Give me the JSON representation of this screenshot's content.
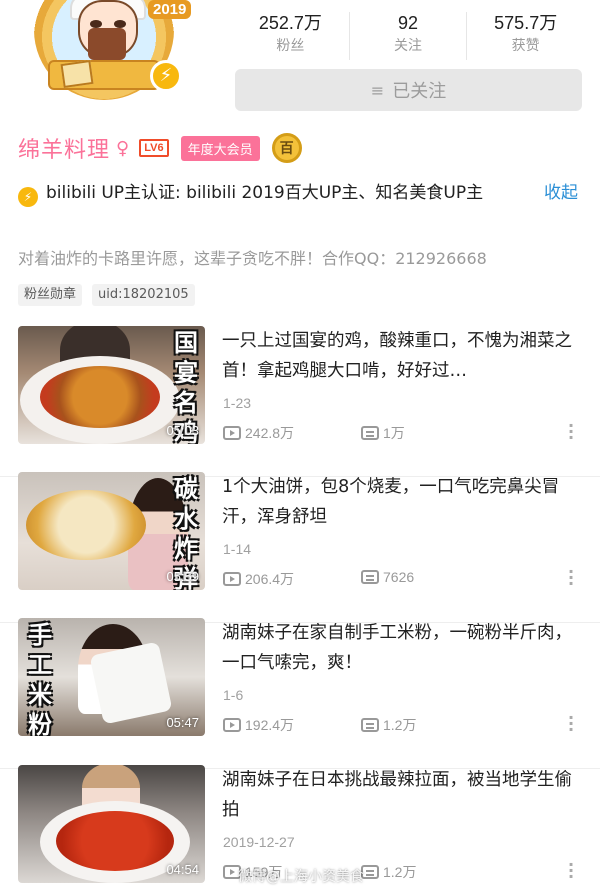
{
  "profile": {
    "avatar_year": "2019",
    "name": "绵羊料理",
    "gender_symbol": "♀",
    "level": "LV6",
    "vip_label": "年度大会员",
    "medal": "百",
    "stats": [
      {
        "value": "252.7万",
        "label": "粉丝"
      },
      {
        "value": "92",
        "label": "关注"
      },
      {
        "value": "575.7万",
        "label": "获赞"
      }
    ],
    "follow_button": "已关注",
    "verification": "bilibili  UP主认证: bilibili  2019百大UP主、知名美食UP主",
    "collapse": "收起",
    "bio": "对着油炸的卡路里许愿，这辈子贪吃不胖！合作QQ：212926668",
    "tags": [
      "粉丝勋章",
      "uid:18202105"
    ]
  },
  "videos": [
    {
      "title": "一只上过国宴的鸡，酸辣重口，不愧为湘菜之首！拿起鸡腿大口啃，好好过…",
      "date": "1-23",
      "views": "242.8万",
      "danmaku": "1万",
      "duration": "05:03",
      "cover_text": "国宴名鸡"
    },
    {
      "title": "1个大油饼，包8个烧麦，一口气吃完鼻尖冒汗，浑身舒坦",
      "date": "1-14",
      "views": "206.4万",
      "danmaku": "7626",
      "duration": "05:59",
      "cover_text": "碳水炸弹"
    },
    {
      "title": "湖南妹子在家自制手工米粉，一碗粉半斤肉，一口气嗦完，爽！",
      "date": "1-6",
      "views": "192.4万",
      "danmaku": "1.2万",
      "duration": "05:47",
      "cover_text": "手工米粉"
    },
    {
      "title": "湖南妹子在日本挑战最辣拉面，被当地学生偷拍",
      "date": "2019-12-27",
      "views": "159万",
      "danmaku": "1.2万",
      "duration": "04:54",
      "cover_text": ""
    }
  ],
  "watermark": "微博@上海小资美食"
}
